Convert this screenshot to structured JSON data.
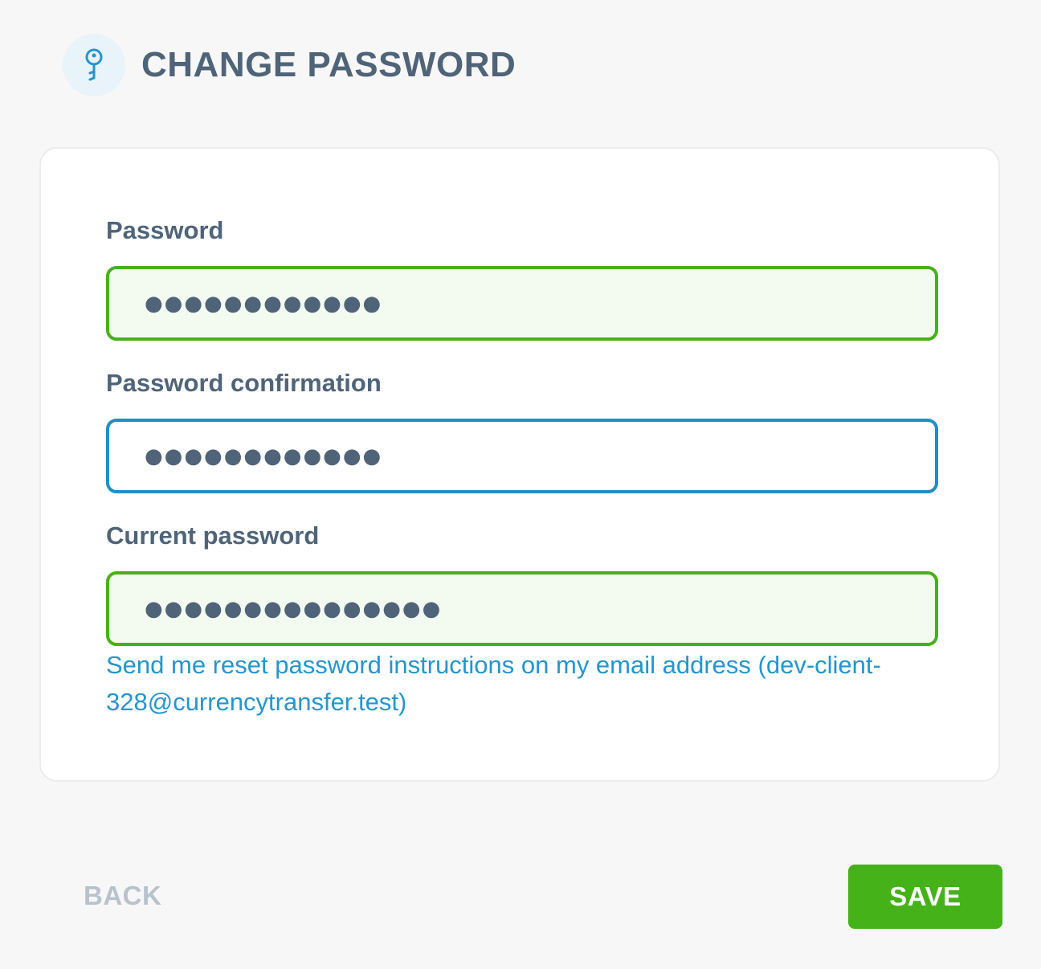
{
  "header": {
    "icon": "key-icon",
    "title": "CHANGE PASSWORD"
  },
  "form": {
    "password": {
      "label": "Password",
      "value": "●●●●●●●●●●●●",
      "state": "valid"
    },
    "password_confirmation": {
      "label": "Password confirmation",
      "value": "●●●●●●●●●●●●",
      "state": "focused"
    },
    "current_password": {
      "label": "Current password",
      "value": "●●●●●●●●●●●●●●●",
      "state": "valid"
    },
    "reset_link": "Send me reset password instructions on my email address (dev-client-328@currencytransfer.test)"
  },
  "footer": {
    "back_label": "BACK",
    "save_label": "SAVE"
  },
  "colors": {
    "accent_green": "#45b21a",
    "accent_blue": "#1e8fc6",
    "text_primary": "#4f6479",
    "link": "#2396cf"
  }
}
